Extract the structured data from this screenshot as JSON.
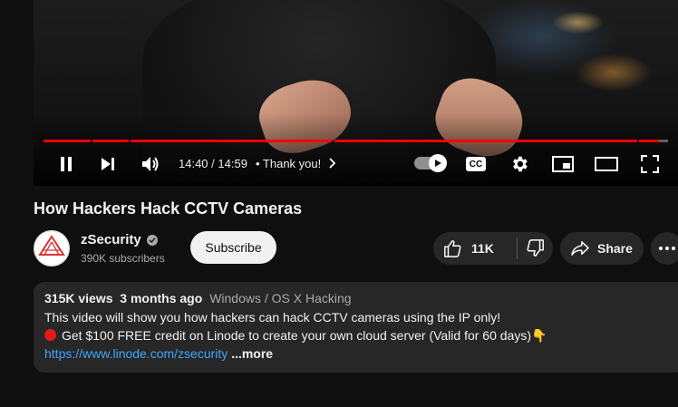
{
  "player": {
    "time_current": "14:40",
    "time_separator": "/",
    "time_total": "14:59",
    "chapter_title": "• Thank you!",
    "progress_fraction": 0.98,
    "icons": [
      "pause-icon",
      "next-icon",
      "volume-icon",
      "autoplay-icon",
      "cc-icon",
      "settings-icon",
      "miniplayer-icon",
      "theater-icon",
      "fullscreen-icon"
    ],
    "cc_label": "CC",
    "accent": "#ff0000"
  },
  "video": {
    "title": "How Hackers Hack CCTV Cameras"
  },
  "channel": {
    "name": "zSecurity",
    "subscribers": "390K subscribers",
    "subscribe_label": "Subscribe"
  },
  "actions": {
    "likes": "11K",
    "share_label": "Share"
  },
  "description": {
    "views": "315K views",
    "age": "3 months ago",
    "category": "Windows / OS X Hacking",
    "line1": "This video will show you how hackers can hack CCTV cameras using the IP only!",
    "line2": "Get $100 FREE credit on Linode to create your own cloud server (Valid for 60 days)👇",
    "link": "https://www.linode.com/zsecurity",
    "more_label": "...more"
  }
}
